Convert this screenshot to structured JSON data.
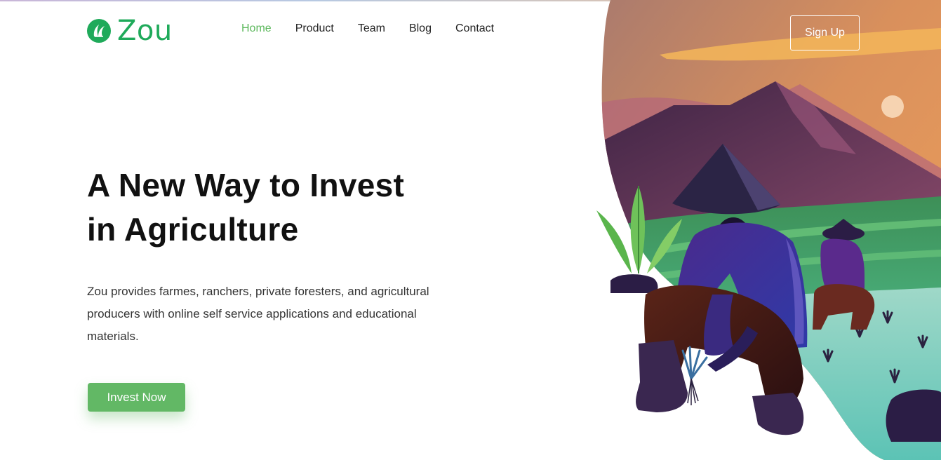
{
  "brand": {
    "name": "Zou",
    "color": "#1faa5a",
    "icon": "leaf-icon"
  },
  "nav": {
    "items": [
      {
        "label": "Home",
        "active": true
      },
      {
        "label": "Product",
        "active": false
      },
      {
        "label": "Team",
        "active": false
      },
      {
        "label": "Blog",
        "active": false
      },
      {
        "label": "Contact",
        "active": false
      }
    ],
    "active_color": "#5cb85c"
  },
  "header": {
    "signup_label": "Sign Up"
  },
  "hero": {
    "headline_line1": "A New Way to Invest",
    "headline_line2": "in Agriculture",
    "description": "Zou provides farmes, ranchers, private foresters, and agricultural producers with online self service applications and educational materials.",
    "cta_label": "Invest Now",
    "cta_color": "#62b865"
  }
}
